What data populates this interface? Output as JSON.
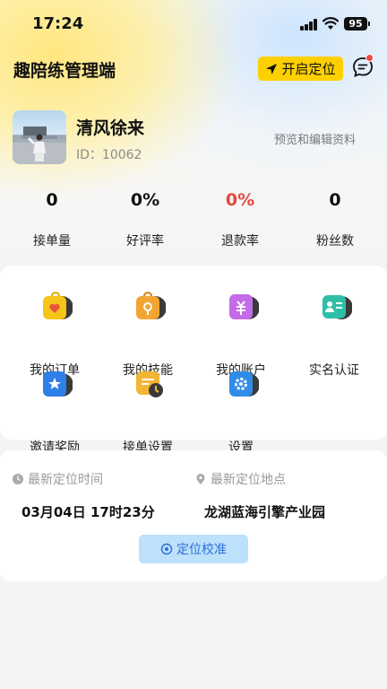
{
  "status_bar": {
    "time": "17:24",
    "battery": "95"
  },
  "header": {
    "title": "趣陪练管理端",
    "locate_button": "开启定位"
  },
  "profile": {
    "name": "清风徐来",
    "id_label": "ID：",
    "id_value": "10062",
    "edit_link": "预览和编辑资料"
  },
  "stats": [
    {
      "value": "0",
      "label": "接单量"
    },
    {
      "value": "0%",
      "label": "好评率"
    },
    {
      "value": "0%",
      "label": "退款率"
    },
    {
      "value": "0",
      "label": "粉丝数"
    }
  ],
  "menu": [
    {
      "label": "我的订单",
      "icon": "orders-bag-icon",
      "color": "#f5c518"
    },
    {
      "label": "我的技能",
      "icon": "skills-bag-icon",
      "color": "#f3a534"
    },
    {
      "label": "我的账户",
      "icon": "account-wallet-icon",
      "color": "#c46be8"
    },
    {
      "label": "实名认证",
      "icon": "id-card-icon",
      "color": "#2fbfa8"
    },
    {
      "label": "邀请奖励",
      "icon": "invite-star-icon",
      "color": "#2f7fe8"
    },
    {
      "label": "接单设置",
      "icon": "order-settings-icon",
      "color": "#f3b534"
    },
    {
      "label": "设置",
      "icon": "settings-gear-icon",
      "color": "#2f8ce8"
    }
  ],
  "location": {
    "time_label": "最新定位时间",
    "place_label": "最新定位地点",
    "time_value": "03月04日 17时23分",
    "place_value": "龙湖蓝海引擎产业园",
    "calibrate_button": "定位校准"
  },
  "colors": {
    "accent_yellow": "#ffd000",
    "red": "#e24a3f",
    "blue": "#2a6fd8"
  }
}
